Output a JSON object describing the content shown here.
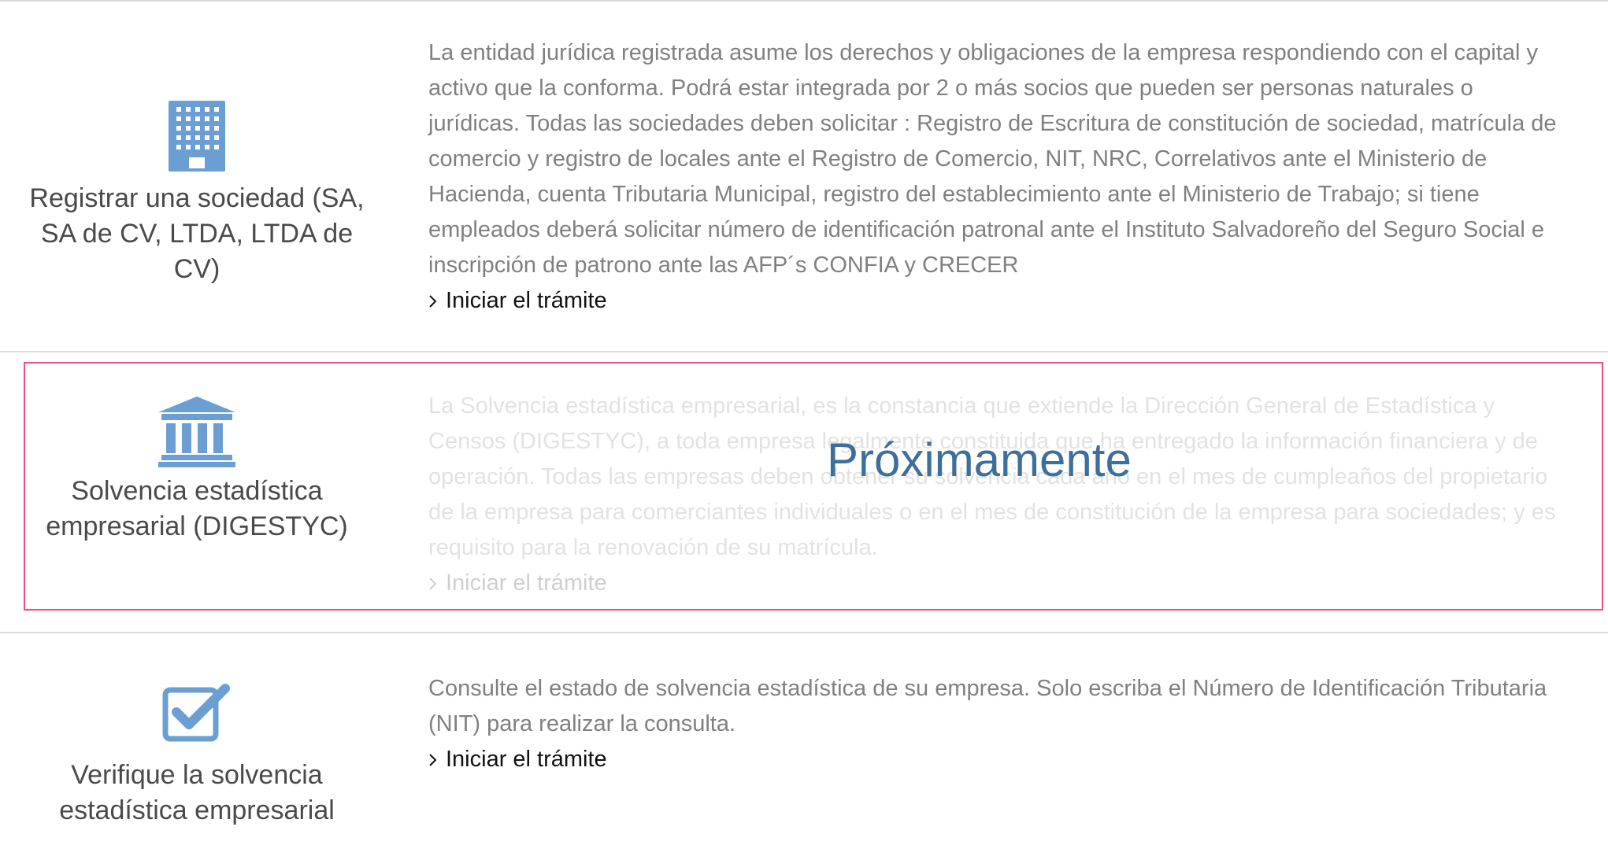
{
  "items": [
    {
      "icon": "building-icon",
      "title": "Registrar una sociedad (SA, SA de CV, LTDA, LTDA de CV)",
      "description": "La entidad jurídica registrada asume los derechos y obligaciones de la empresa respondiendo con el capital y activo que la conforma. Podrá estar integrada por 2 o más socios que pueden ser personas naturales o jurídicas. Todas las sociedades deben solicitar : Registro de Escritura de constitución de sociedad, matrícula de comercio y registro de locales ante el Registro de Comercio, NIT, NRC, Correlativos ante el Ministerio de Hacienda, cuenta Tributaria Municipal, registro del establecimiento ante el Ministerio de Trabajo; si tiene empleados deberá solicitar número de identificación patronal ante el Instituto Salvadoreño del Seguro Social e inscripción de patrono ante las AFP´s CONFIA y CRECER",
      "cta": "Iniciar el trámite"
    },
    {
      "icon": "bank-icon",
      "title": "Solvencia estadística empresarial (DIGESTYC)",
      "description": "La Solvencia estadística empresarial, es la constancia que extiende la Dirección General de Estadística y Censos (DIGESTYC), a toda empresa legalmente constituida que ha entregado la información financiera y de operación. Todas las empresas deben obtener su solvencia cada año en el mes de cumpleaños del propietario de la empresa para comerciantes individuales o en el mes de constitución de la empresa para sociedades; y es requisito para la renovación de su matrícula.",
      "cta": "Iniciar el trámite",
      "overlay": "Próximamente"
    },
    {
      "icon": "checkbox-check-icon",
      "title": "Verifique la solvencia estadística empresarial",
      "description": "Consulte el estado de solvencia estadística de su empresa. Solo escriba el Número de Identificación Tributaria (NIT) para realizar la consulta.",
      "cta": "Iniciar el trámite"
    }
  ],
  "colors": {
    "icon_blue": "#6b9fd4",
    "highlight_border": "#ec4c8e",
    "overlay_text": "#3e6f9a"
  }
}
